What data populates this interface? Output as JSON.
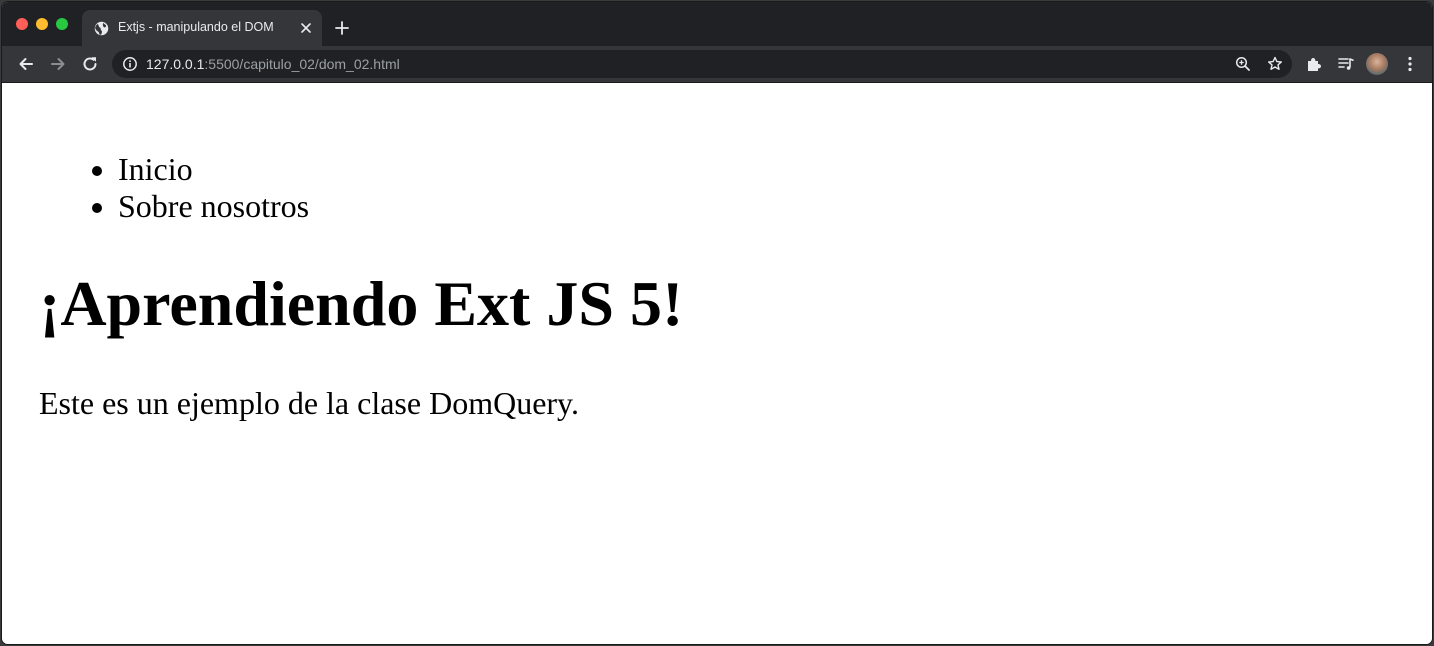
{
  "browser": {
    "tab": {
      "title": "Extjs - manipulando el DOM",
      "favicon": "globe-icon"
    },
    "address_bar": {
      "host": "127.0.0.1",
      "rest": ":5500/capitulo_02/dom_02.html"
    },
    "icons": {
      "back": "arrow-left-icon",
      "forward": "arrow-right-icon",
      "reload": "reload-icon",
      "site_info": "info-icon",
      "zoom": "zoom-icon",
      "bookmark": "star-icon",
      "extensions": "puzzle-icon",
      "media": "media-queue-icon",
      "menu": "kebab-menu-icon"
    },
    "colors": {
      "tabstrip": "#202124",
      "toolbar": "#35363a",
      "close_light": "#ff5f57",
      "minimize_light": "#febc2e",
      "zoom_light": "#28c840"
    }
  },
  "page": {
    "nav_items": [
      "Inicio",
      "Sobre nosotros"
    ],
    "heading": "¡Aprendiendo Ext JS 5!",
    "paragraph": "Este es un ejemplo de la clase DomQuery."
  }
}
